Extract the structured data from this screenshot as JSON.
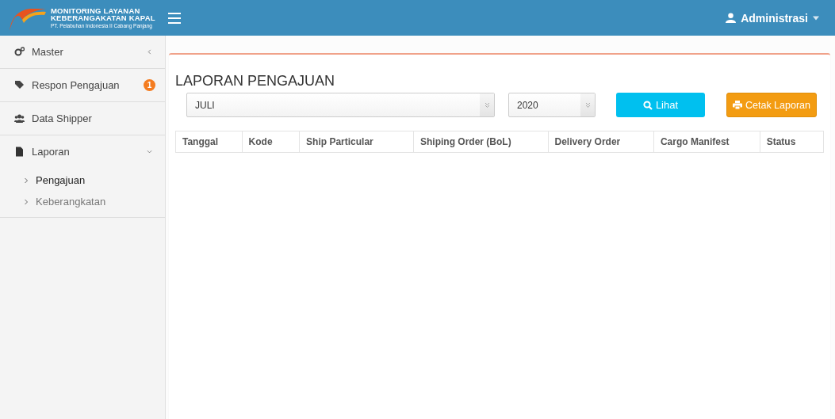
{
  "header": {
    "logo_title": [
      "MONITORING LAYANAN",
      "KEBERANGAKATAN KAPAL"
    ],
    "logo_subtitle": "PT. Pelabuhan Indonesia II Cabang Panjang",
    "user": "Administrasi"
  },
  "sidebar": {
    "items": [
      {
        "kind": "gears",
        "label": "Master",
        "expanded": false
      },
      {
        "kind": "tag",
        "label": "Respon Pengajuan",
        "badge": "1"
      },
      {
        "kind": "users",
        "label": "Data Shipper"
      },
      {
        "kind": "file",
        "label": "Laporan",
        "expanded": true,
        "children": [
          {
            "label": "Pengajuan",
            "selected": true
          },
          {
            "label": "Keberangkatan",
            "selected": false
          }
        ]
      }
    ]
  },
  "report": {
    "title": "LAPORAN PENGAJUAN",
    "month": "JULI",
    "year": "2020",
    "buttons": [
      {
        "kind": "search",
        "label": "Lihat"
      },
      {
        "kind": "print",
        "label": "Cetak Laporan"
      }
    ],
    "table": {
      "columns": [
        "Tanggal",
        "Kode",
        "Ship Particular",
        "Shiping Order (BoL)",
        "Delivery Order",
        "Cargo Manifest",
        "Status"
      ]
    }
  }
}
